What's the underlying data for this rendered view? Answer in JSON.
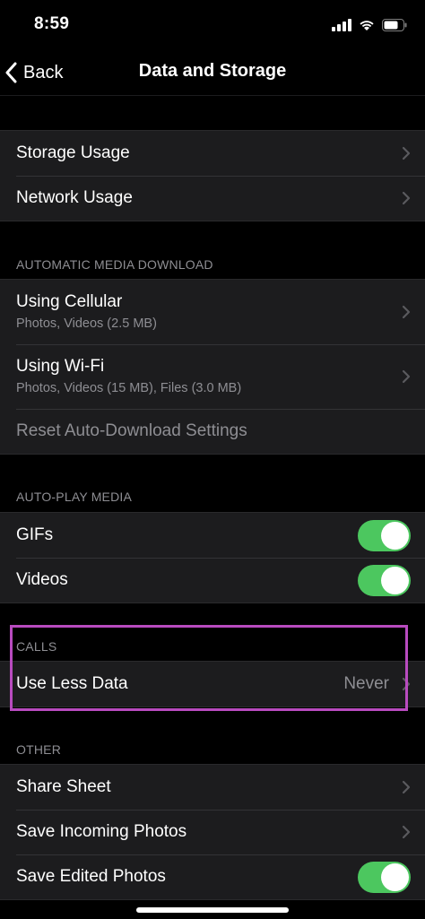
{
  "status": {
    "time": "8:59",
    "icons": [
      "signal-icon",
      "wifi-icon",
      "battery-icon"
    ]
  },
  "nav": {
    "back_label": "Back",
    "title": "Data and Storage"
  },
  "usage": {
    "items": [
      {
        "label": "Storage Usage"
      },
      {
        "label": "Network Usage"
      }
    ]
  },
  "auto_download": {
    "header": "AUTOMATIC MEDIA DOWNLOAD",
    "cellular": {
      "label": "Using Cellular",
      "detail": "Photos, Videos (2.5 MB)"
    },
    "wifi": {
      "label": "Using Wi-Fi",
      "detail": "Photos, Videos (15 MB), Files (3.0 MB)"
    },
    "reset_label": "Reset Auto-Download Settings"
  },
  "autoplay": {
    "header": "AUTO-PLAY MEDIA",
    "gifs": {
      "label": "GIFs",
      "on": true
    },
    "videos": {
      "label": "Videos",
      "on": true
    }
  },
  "calls": {
    "header": "CALLS",
    "use_less_data": {
      "label": "Use Less Data",
      "value": "Never"
    }
  },
  "other": {
    "header": "OTHER",
    "share_sheet": {
      "label": "Share Sheet"
    },
    "save_incoming": {
      "label": "Save Incoming Photos"
    },
    "save_edited": {
      "label": "Save Edited Photos",
      "on": true
    }
  },
  "colors": {
    "toggle_on": "#4cc75f",
    "highlight": "#b84bbf",
    "secondary_text": "#8e8e93"
  }
}
